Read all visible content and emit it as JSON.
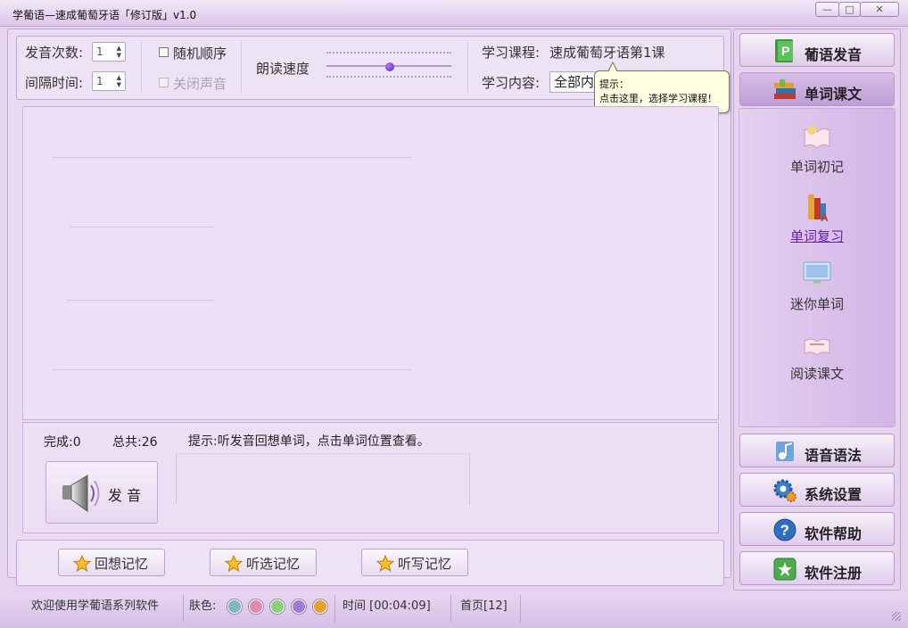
{
  "window": {
    "title": "学葡语—速成葡萄牙语「修订版」v1.0",
    "buttons": [
      "—",
      "□",
      "✕"
    ]
  },
  "controls": {
    "repeat_label": "发音次数:",
    "repeat_value": "1",
    "interval_label": "间隔时间:",
    "interval_value": "1",
    "random_label": "随机顺序",
    "mute_label": "关闭声音",
    "speed_label": "朗读速度",
    "course_label": "学习课程:",
    "course_value": "速成葡萄牙语第1课",
    "content_label": "学习内容:",
    "content_value": "全部内"
  },
  "tooltip": {
    "title": "提示：",
    "text": "点击这里，选择学习课程！"
  },
  "bottom_panel": {
    "done_label": "完成:0",
    "total_label": "总共:26",
    "hint": "提示:听发音回想单词，点击单词位置查看。",
    "speak_label": "发 音"
  },
  "memory_buttons": [
    "回想记忆",
    "听选记忆",
    "听写记忆"
  ],
  "sidebar": {
    "top_buttons": [
      "葡语发音",
      "单词课文"
    ],
    "items": [
      "单词初记",
      "单词复习",
      "迷你单词",
      "阅读课文"
    ],
    "bottom_buttons": [
      "语音语法",
      "系统设置",
      "软件帮助",
      "软件注册"
    ]
  },
  "status": {
    "welcome": "欢迎使用学葡语系列软件",
    "skin_label": "肤色:",
    "skin_colors": [
      "#7fb7c4",
      "#e08ab0",
      "#8ccf7e",
      "#a07ad8",
      "#e3a22a"
    ],
    "time": "时间 [00:04:09]",
    "page": "首页[12]"
  },
  "colors": {
    "accent": "#7b2fbe",
    "link": "#6a1fb0",
    "panel": "#eddff5"
  }
}
